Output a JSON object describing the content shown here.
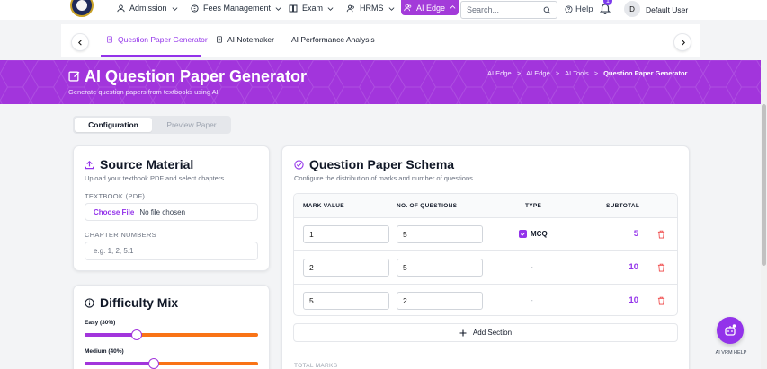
{
  "nav": {
    "items": [
      {
        "label": "Admission"
      },
      {
        "label": "Fees Management"
      },
      {
        "label": "Exam"
      },
      {
        "label": "HRMS"
      }
    ],
    "active_label": "AI Edge",
    "search_placeholder": "Search...",
    "help_label": "Help",
    "notification_count": "1",
    "avatar_initial": "D",
    "user_name": "Default User"
  },
  "subnav": {
    "tabs": [
      {
        "label": "Question Paper Generator"
      },
      {
        "label": "AI Notemaker"
      },
      {
        "label": "AI Performance Analysis"
      }
    ]
  },
  "banner": {
    "title": "AI Question Paper Generator",
    "subtitle": "Generate question papers from textbooks using AI",
    "breadcrumbs": [
      "AI Edge",
      ">",
      "AI Edge",
      ">",
      "AI Tools",
      ">",
      "Question Paper Generator"
    ]
  },
  "config_tabs": {
    "configuration": "Configuration",
    "preview": "Preview Paper"
  },
  "source": {
    "title": "Source Material",
    "subtitle": "Upload your textbook PDF and select chapters.",
    "textbook_label": "TEXTBOOK (PDF)",
    "choose_file": "Choose File",
    "no_file": "No file chosen",
    "chapter_label": "CHAPTER NUMBERS",
    "chapter_placeholder": "e.g. 1, 2, 5.1"
  },
  "difficulty": {
    "title": "Difficulty Mix",
    "levels": [
      {
        "label": "Easy (30%)",
        "value": 30
      },
      {
        "label": "Medium (40%)",
        "value": 40
      }
    ]
  },
  "schema": {
    "title": "Question Paper Schema",
    "subtitle": "Configure the distribution of marks and number of questions.",
    "headers": {
      "mark": "MARK VALUE",
      "num": "NO. OF QUESTIONS",
      "type": "TYPE",
      "subtotal": "SUBTOTAL"
    },
    "rows": [
      {
        "mark": "1",
        "num": "5",
        "type": "MCQ",
        "subtotal": "5"
      },
      {
        "mark": "2",
        "num": "5",
        "type": "-",
        "subtotal": "10"
      },
      {
        "mark": "5",
        "num": "2",
        "type": "-",
        "subtotal": "10"
      }
    ],
    "add_section": "Add Section",
    "total_label": "TOTAL MARKS"
  },
  "fab": {
    "label": "AI VRM HELP"
  },
  "colors": {
    "accent": "#9333ea",
    "banner": "#a235dc",
    "slider_rest": "#f97316",
    "danger": "#ef4444"
  }
}
